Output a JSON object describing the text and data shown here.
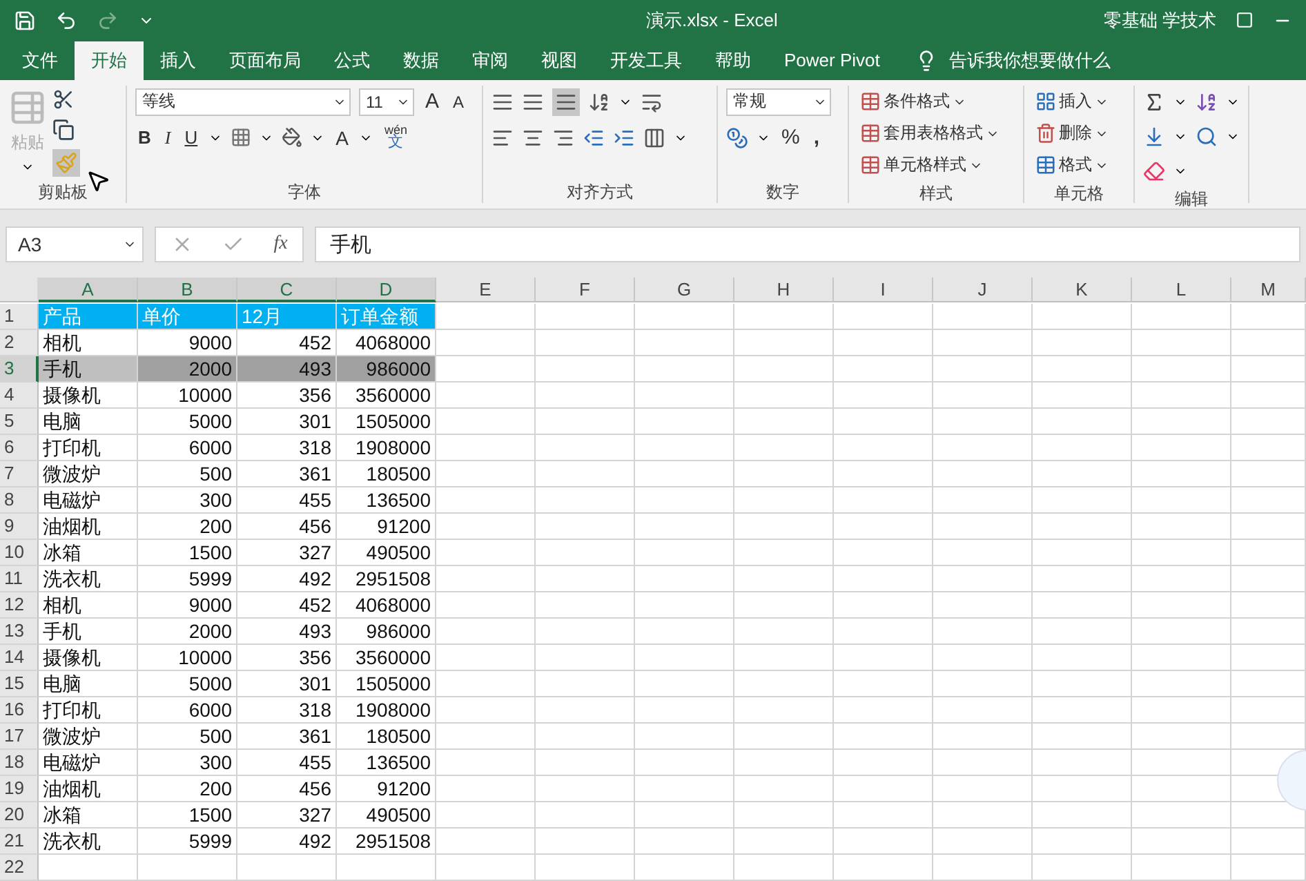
{
  "title_bar": {
    "title": "演示.xlsx  -  Excel",
    "user": "零基础 学技术"
  },
  "menu_tabs": [
    {
      "label": "文件",
      "selected": false
    },
    {
      "label": "开始",
      "selected": true
    },
    {
      "label": "插入",
      "selected": false
    },
    {
      "label": "页面布局",
      "selected": false
    },
    {
      "label": "公式",
      "selected": false
    },
    {
      "label": "数据",
      "selected": false
    },
    {
      "label": "审阅",
      "selected": false
    },
    {
      "label": "视图",
      "selected": false
    },
    {
      "label": "开发工具",
      "selected": false
    },
    {
      "label": "帮助",
      "selected": false
    },
    {
      "label": "Power Pivot",
      "selected": false
    }
  ],
  "tell_me": "告诉我你想要做什么",
  "ribbon": {
    "clipboard": {
      "paste": "粘贴",
      "label": "剪贴板"
    },
    "font": {
      "name": "等线",
      "size": "11",
      "grow": "A",
      "shrink": "A",
      "bold": "B",
      "italic": "I",
      "underline": "U",
      "font_color": "A",
      "phonetic_top": "wén",
      "phonetic_bottom": "文",
      "label": "字体"
    },
    "alignment": {
      "label": "对齐方式"
    },
    "number": {
      "format": "常规",
      "percent": "%",
      "comma": ",",
      "label": "数字"
    },
    "styles": {
      "items": [
        "条件格式",
        "套用表格格式",
        "单元格样式"
      ],
      "label": "样式"
    },
    "cells": {
      "items": [
        "插入",
        "删除",
        "格式"
      ],
      "label": "单元格"
    },
    "editing": {
      "label": "编辑"
    }
  },
  "formula_bar": {
    "name_box": "A3",
    "fx": "fx",
    "value": "手机"
  },
  "columns": [
    {
      "label": "A",
      "selected": true,
      "kind": "text"
    },
    {
      "label": "B",
      "selected": true,
      "kind": "number"
    },
    {
      "label": "C",
      "selected": true,
      "kind": "number"
    },
    {
      "label": "D",
      "selected": true,
      "kind": "number"
    },
    {
      "label": "E",
      "selected": false,
      "kind": "text"
    },
    {
      "label": "F",
      "selected": false,
      "kind": "text"
    },
    {
      "label": "G",
      "selected": false,
      "kind": "text"
    },
    {
      "label": "H",
      "selected": false,
      "kind": "text"
    },
    {
      "label": "I",
      "selected": false,
      "kind": "text"
    },
    {
      "label": "J",
      "selected": false,
      "kind": "text"
    },
    {
      "label": "K",
      "selected": false,
      "kind": "text"
    },
    {
      "label": "L",
      "selected": false,
      "kind": "text"
    },
    {
      "label": "M",
      "selected": false,
      "kind": "text"
    }
  ],
  "rows": [
    {
      "number": "1",
      "kind": "header",
      "selected": false,
      "cells": [
        "产品",
        "单价",
        "12月",
        "订单金额"
      ]
    },
    {
      "number": "2",
      "kind": "data",
      "selected": false,
      "cells": [
        "相机",
        "9000",
        "452",
        "4068000"
      ]
    },
    {
      "number": "3",
      "kind": "data",
      "selected": true,
      "cells": [
        "手机",
        "2000",
        "493",
        "986000"
      ]
    },
    {
      "number": "4",
      "kind": "data",
      "selected": false,
      "cells": [
        "摄像机",
        "10000",
        "356",
        "3560000"
      ]
    },
    {
      "number": "5",
      "kind": "data",
      "selected": false,
      "cells": [
        "电脑",
        "5000",
        "301",
        "1505000"
      ]
    },
    {
      "number": "6",
      "kind": "data",
      "selected": false,
      "cells": [
        "打印机",
        "6000",
        "318",
        "1908000"
      ]
    },
    {
      "number": "7",
      "kind": "data",
      "selected": false,
      "cells": [
        "微波炉",
        "500",
        "361",
        "180500"
      ]
    },
    {
      "number": "8",
      "kind": "data",
      "selected": false,
      "cells": [
        "电磁炉",
        "300",
        "455",
        "136500"
      ]
    },
    {
      "number": "9",
      "kind": "data",
      "selected": false,
      "cells": [
        "油烟机",
        "200",
        "456",
        "91200"
      ]
    },
    {
      "number": "10",
      "kind": "data",
      "selected": false,
      "cells": [
        "冰箱",
        "1500",
        "327",
        "490500"
      ]
    },
    {
      "number": "11",
      "kind": "data",
      "selected": false,
      "cells": [
        "洗衣机",
        "5999",
        "492",
        "2951508"
      ]
    },
    {
      "number": "12",
      "kind": "data",
      "selected": false,
      "cells": [
        "相机",
        "9000",
        "452",
        "4068000"
      ]
    },
    {
      "number": "13",
      "kind": "data",
      "selected": false,
      "cells": [
        "手机",
        "2000",
        "493",
        "986000"
      ]
    },
    {
      "number": "14",
      "kind": "data",
      "selected": false,
      "cells": [
        "摄像机",
        "10000",
        "356",
        "3560000"
      ]
    },
    {
      "number": "15",
      "kind": "data",
      "selected": false,
      "cells": [
        "电脑",
        "5000",
        "301",
        "1505000"
      ]
    },
    {
      "number": "16",
      "kind": "data",
      "selected": false,
      "cells": [
        "打印机",
        "6000",
        "318",
        "1908000"
      ]
    },
    {
      "number": "17",
      "kind": "data",
      "selected": false,
      "cells": [
        "微波炉",
        "500",
        "361",
        "180500"
      ]
    },
    {
      "number": "18",
      "kind": "data",
      "selected": false,
      "cells": [
        "电磁炉",
        "300",
        "455",
        "136500"
      ]
    },
    {
      "number": "19",
      "kind": "data",
      "selected": false,
      "cells": [
        "油烟机",
        "200",
        "456",
        "91200"
      ]
    },
    {
      "number": "20",
      "kind": "data",
      "selected": false,
      "cells": [
        "冰箱",
        "1500",
        "327",
        "490500"
      ]
    },
    {
      "number": "21",
      "kind": "data",
      "selected": false,
      "cells": [
        "洗衣机",
        "5999",
        "492",
        "2951508"
      ]
    },
    {
      "number": "22",
      "kind": "data",
      "selected": false,
      "cells": []
    }
  ]
}
